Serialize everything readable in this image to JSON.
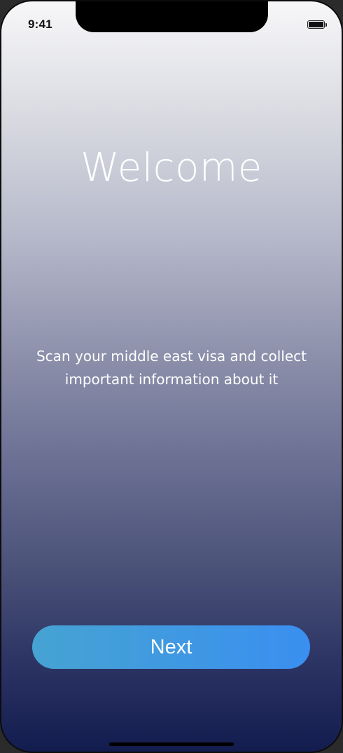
{
  "status_bar": {
    "time": "9:41",
    "battery_icon": "battery-full-icon"
  },
  "welcome": {
    "title": "Welcome",
    "description": "Scan your middle east visa and collect important information about it"
  },
  "actions": {
    "next_label": "Next"
  },
  "colors": {
    "gradient_top": "#f7f7f9",
    "gradient_bottom": "#121c4e",
    "button_start": "#46a3d2",
    "button_end": "#3a8ff0",
    "text": "#ffffff"
  }
}
